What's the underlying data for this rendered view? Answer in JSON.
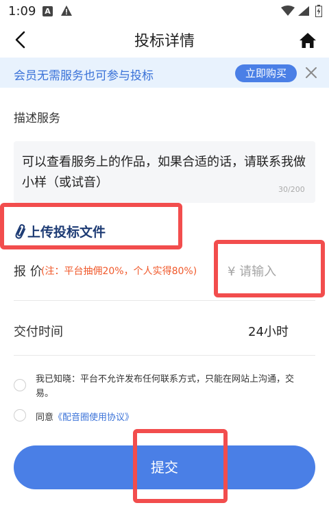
{
  "status_bar": {
    "time": "1:09",
    "a_badge": "A"
  },
  "header": {
    "title": "投标详情"
  },
  "banner": {
    "text": "会员无需服务也可参与投标",
    "buy_label": "立即购买"
  },
  "describe": {
    "label": "描述服务",
    "text": "可以查看服务上的作品，如果合适的话，请联系我做小样（或试音）",
    "count": "30/200"
  },
  "upload": {
    "label": "上传投标文件"
  },
  "price": {
    "label": "报 价",
    "note": "(注：平台抽佣20%，个人实得80%)",
    "placeholder": "¥ 请输入",
    "value": ""
  },
  "delivery": {
    "label": "交付时间",
    "value": "24小时"
  },
  "notice": {
    "text": "我已知晓：平台不允许发布任何联系方式，只能在网站上沟通，交易。"
  },
  "agree": {
    "prefix": "同意",
    "link": "《配音圈使用协议》"
  },
  "submit": {
    "label": "提交"
  },
  "colors": {
    "accent": "#4a7fe6",
    "banner_bg": "#e8f2fd",
    "note_red": "#f0582a",
    "annotation": "#f24d4d"
  }
}
